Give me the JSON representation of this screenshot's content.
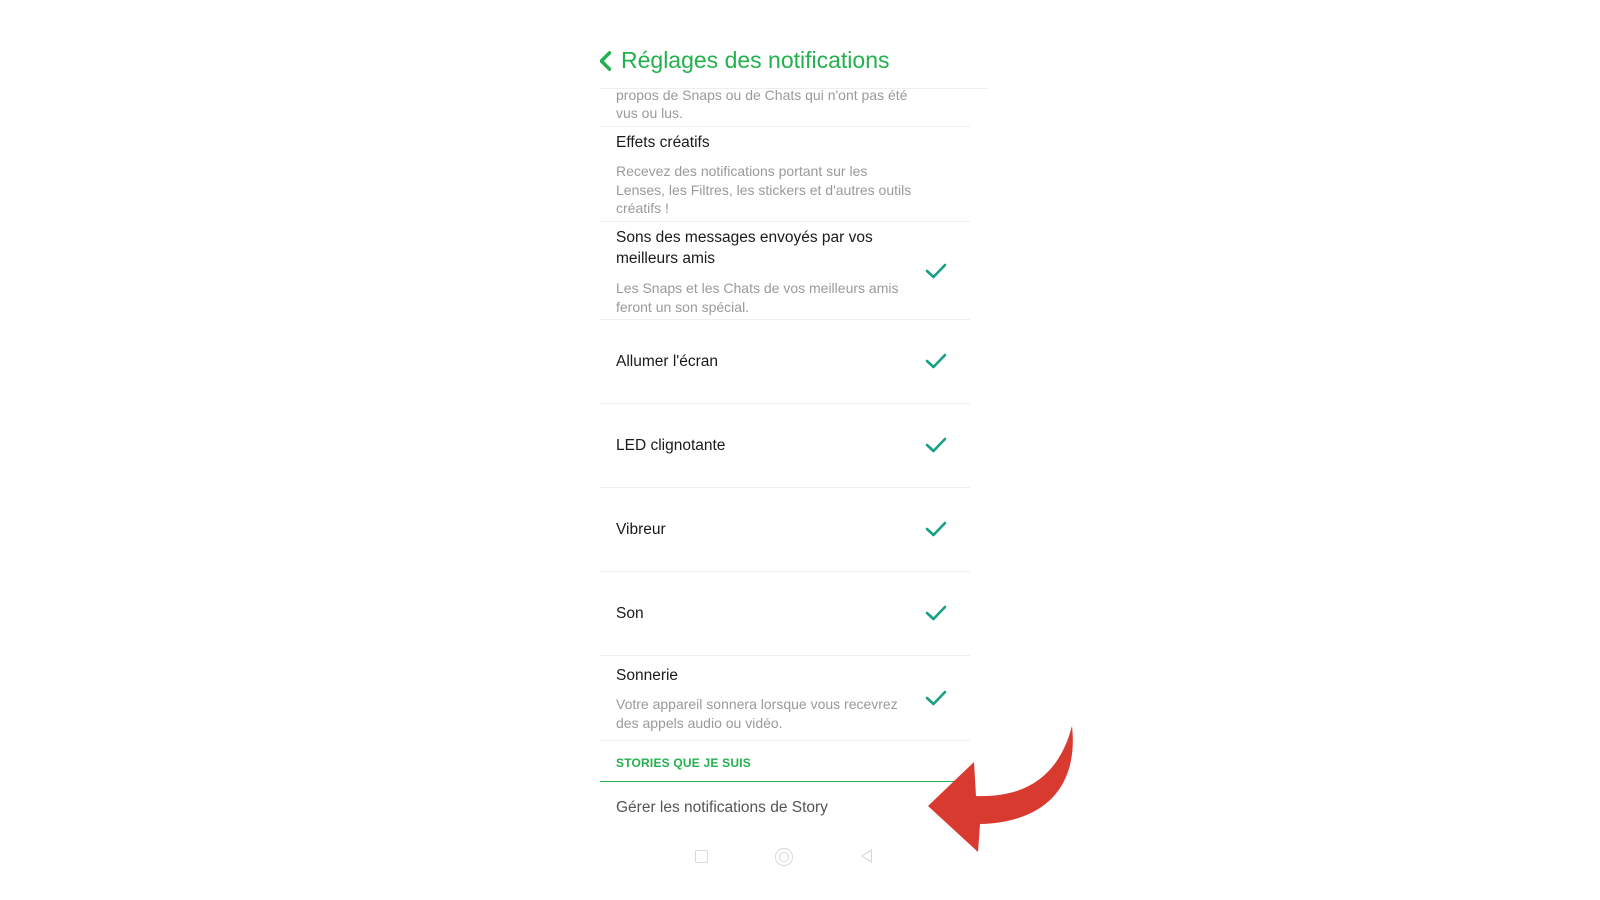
{
  "header": {
    "title": "Réglages des notifications",
    "back_icon": "chevron-left-icon"
  },
  "partial_text": "propos de Snaps ou de Chats qui n'ont pas été vus ou lus.",
  "items": [
    {
      "title": "Effets créatifs",
      "desc": "Recevez des notifications portant sur les Lenses, les Filtres, les stickers et d'autres outils créatifs !",
      "checked": false
    },
    {
      "title": "Sons des messages envoyés par vos meilleurs amis",
      "desc": "Les Snaps et les Chats de vos meilleurs amis feront un son spécial.",
      "checked": true
    },
    {
      "title": "Allumer l'écran",
      "checked": true
    },
    {
      "title": "LED clignotante",
      "checked": true
    },
    {
      "title": "Vibreur",
      "checked": true
    },
    {
      "title": "Son",
      "checked": true
    },
    {
      "title": "Sonnerie",
      "desc": "Votre appareil sonnera lorsque vous recevrez des appels audio ou vidéo.",
      "checked": true
    }
  ],
  "section": {
    "label": "STORIES QUE JE SUIS",
    "item": "Gérer les notifications de Story"
  },
  "colors": {
    "accent": "#22b14c",
    "check": "#16a085",
    "arrow": "#d93a30"
  },
  "icons": {
    "check": "check-icon",
    "arrow": "red-curved-arrow"
  }
}
